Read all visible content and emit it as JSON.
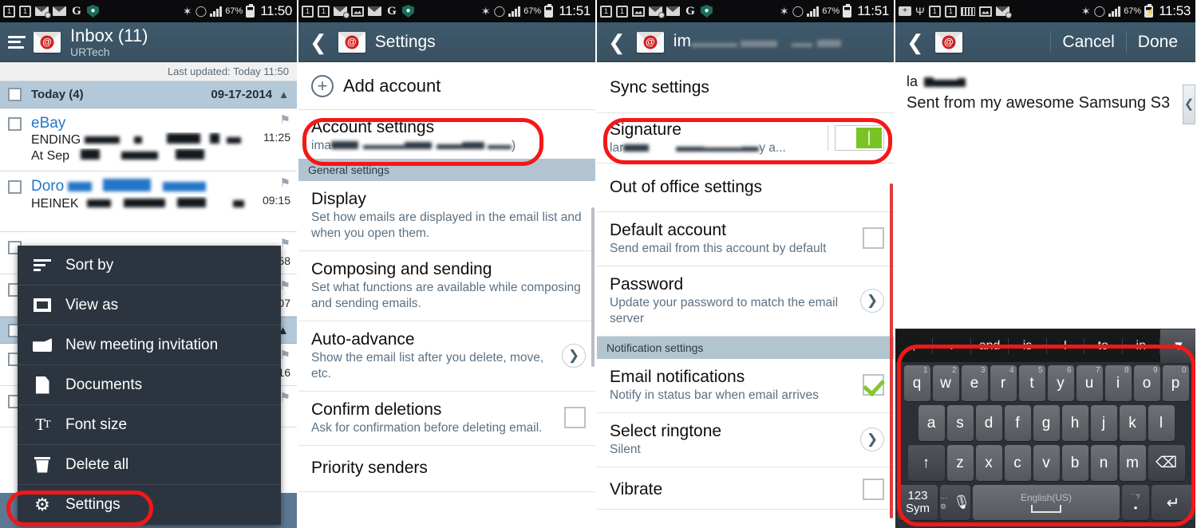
{
  "panels": [
    {
      "status": {
        "time": "11:50",
        "battery": "67%"
      },
      "actionbar": {
        "title": "Inbox (11)",
        "subtitle": "URTech"
      },
      "list": {
        "last_updated": "Last updated: Today 11:50",
        "group": {
          "label": "Today (4)",
          "date": "09-17-2014"
        },
        "emails": [
          {
            "sender": "eBay",
            "line1": "ENDING",
            "line2": "At Sep",
            "time": "11:25"
          },
          {
            "sender": "Doro",
            "line1": "HEINEK",
            "line2": "",
            "time": "09:15"
          }
        ],
        "hidden_times": [
          "58",
          "07",
          "16"
        ]
      },
      "menu": {
        "items": [
          {
            "label": "Sort by",
            "icon": "sort-icon"
          },
          {
            "label": "View as",
            "icon": "view-as-icon"
          },
          {
            "label": "New meeting invitation",
            "icon": "meeting-icon"
          },
          {
            "label": "Documents",
            "icon": "document-icon"
          },
          {
            "label": "Font size",
            "icon": "font-size-icon"
          },
          {
            "label": "Delete all",
            "icon": "trash-icon"
          },
          {
            "label": "Settings",
            "icon": "gear-icon"
          }
        ]
      }
    },
    {
      "status": {
        "time": "11:51",
        "battery": "67%"
      },
      "actionbar": {
        "title": "Settings"
      },
      "add_account": "Add account",
      "account_settings": {
        "title": "Account settings",
        "subtitle_prefix": "ima",
        "subtitle_suffix": ")"
      },
      "section_header": "General settings",
      "rows": [
        {
          "title": "Display",
          "sub": "Set how emails are displayed in the email list and when you open them.",
          "control": "none"
        },
        {
          "title": "Composing and sending",
          "sub": "Set what functions are available while composing and sending emails.",
          "control": "none"
        },
        {
          "title": "Auto-advance",
          "sub": "Show the email list after you delete, move, etc.",
          "control": "chevron"
        },
        {
          "title": "Confirm deletions",
          "sub": "Ask for confirmation before deleting email.",
          "control": "checkbox-unchecked"
        },
        {
          "title": "Priority senders",
          "sub": "",
          "control": "none"
        }
      ]
    },
    {
      "status": {
        "time": "11:51",
        "battery": "67%"
      },
      "actionbar": {
        "title_prefix": "im"
      },
      "rows": [
        {
          "title": "Sync settings",
          "sub": "",
          "control": "none"
        },
        {
          "title": "Signature",
          "sub_prefix": "lar",
          "sub_suffix": "y a...",
          "control": "toggle-on"
        },
        {
          "title": "Out of office settings",
          "sub": "",
          "control": "none"
        },
        {
          "title": "Default account",
          "sub": "Send email from this account by default",
          "control": "checkbox-unchecked"
        },
        {
          "title": "Password",
          "sub": "Update your password to match the email server",
          "control": "chevron"
        }
      ],
      "section_header": "Notification settings",
      "rows2": [
        {
          "title": "Email notifications",
          "sub": "Notify in status bar when email arrives",
          "control": "checkbox-checked"
        },
        {
          "title": "Select ringtone",
          "sub": "Silent",
          "control": "chevron"
        },
        {
          "title": "Vibrate",
          "sub": "",
          "control": "checkbox-unchecked"
        }
      ]
    },
    {
      "status": {
        "time": "11:53",
        "battery": "67%"
      },
      "actionbar": {
        "cancel": "Cancel",
        "done": "Done"
      },
      "signature": {
        "line1_prefix": "la",
        "line2": "Sent from my awesome Samsung S3"
      },
      "keyboard": {
        "suggestions": [
          ",",
          ".",
          "and",
          "is",
          "I",
          "to",
          "in"
        ],
        "row1": [
          {
            "k": "q",
            "n": "1"
          },
          {
            "k": "w",
            "n": "2"
          },
          {
            "k": "e",
            "n": "3"
          },
          {
            "k": "r",
            "n": "4"
          },
          {
            "k": "t",
            "n": "5"
          },
          {
            "k": "y",
            "n": "6"
          },
          {
            "k": "u",
            "n": "7"
          },
          {
            "k": "i",
            "n": "8"
          },
          {
            "k": "o",
            "n": "9"
          },
          {
            "k": "p",
            "n": "0"
          }
        ],
        "row2": [
          "a",
          "s",
          "d",
          "f",
          "g",
          "h",
          "j",
          "k",
          "l"
        ],
        "row3": [
          "z",
          "x",
          "c",
          "v",
          "b",
          "n",
          "m"
        ],
        "shift_label": "↑",
        "delete_label": "⌫",
        "sym_line1": "123",
        "sym_line2": "Sym",
        "mic_label": "🎙",
        "space_lang": "English(US)",
        "dot_hint": "˙˙?",
        "dot_label": "•",
        "enter_label": "↵"
      }
    }
  ],
  "colors": {
    "accent_header": "#3a5161",
    "highlight_ring": "#f51717",
    "toggle_on": "#79c326",
    "check_green": "#86c531",
    "link_blue": "#2576c8"
  }
}
